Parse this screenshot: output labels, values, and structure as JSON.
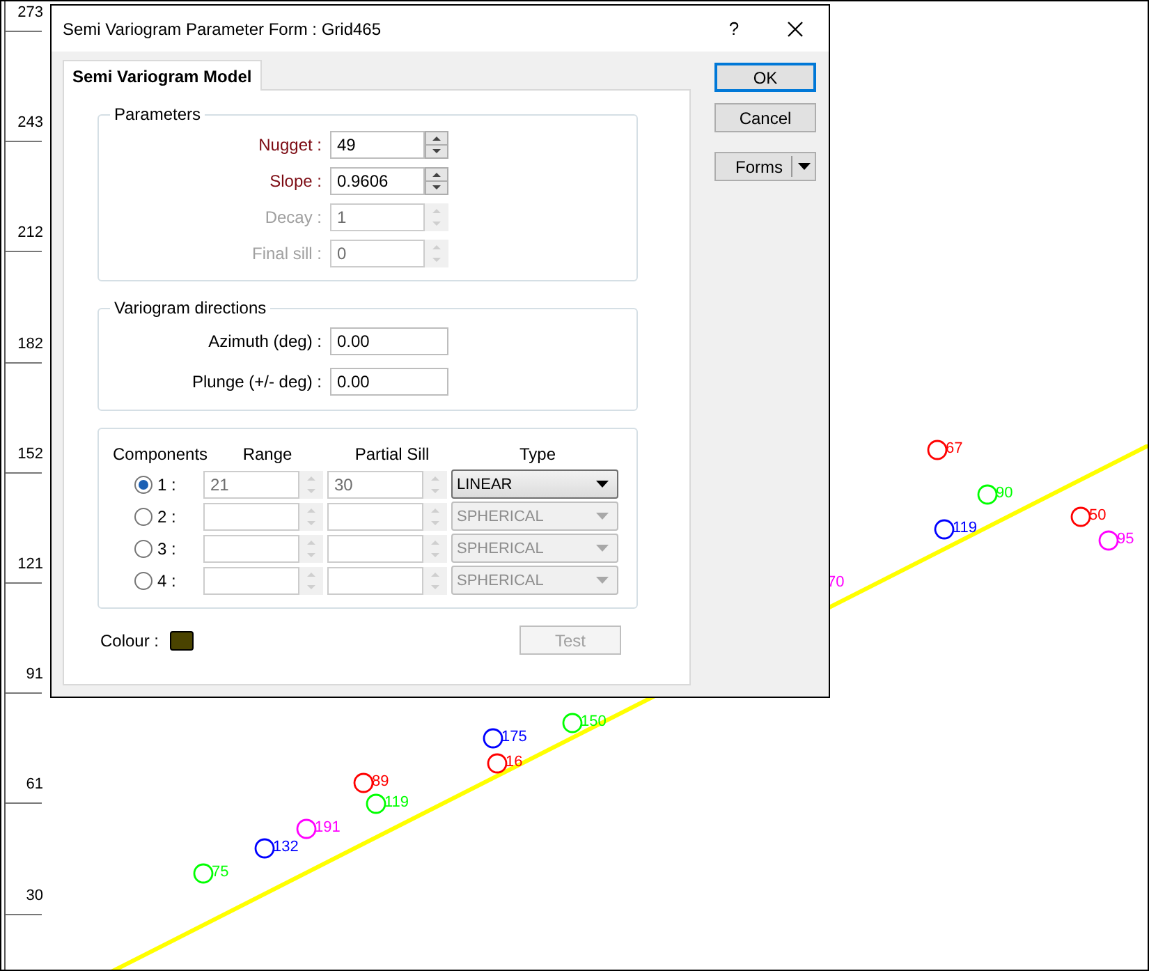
{
  "plot": {
    "y_axis_labels": [
      "273",
      "243",
      "212",
      "182",
      "152",
      "121",
      "91",
      "61",
      "30"
    ],
    "points": [
      {
        "label": "67",
        "color": "#ff0000"
      },
      {
        "label": "90",
        "color": "#00ff00"
      },
      {
        "label": "119",
        "color": "#0000ff"
      },
      {
        "label": "50",
        "color": "#ff0000"
      },
      {
        "label": "95",
        "color": "#ff00ff"
      },
      {
        "label": "175",
        "color": "#0000ff"
      },
      {
        "label": "16",
        "color": "#ff0000"
      },
      {
        "label": "150",
        "color": "#00ff00"
      },
      {
        "label": "89",
        "color": "#ff0000"
      },
      {
        "label": "119",
        "color": "#00ff00"
      },
      {
        "label": "191",
        "color": "#ff00ff"
      },
      {
        "label": "132",
        "color": "#0000ff"
      },
      {
        "label": "75",
        "color": "#00ff00"
      }
    ],
    "hidden_point_labels": [
      {
        "label": "70",
        "color": "#ff00ff"
      }
    ]
  },
  "dialog": {
    "title": "Semi Variogram Parameter Form : Grid465",
    "help": "?",
    "tabs": [
      {
        "label": "Semi Variogram Model",
        "selected": true
      }
    ],
    "parameters": {
      "title": "Parameters",
      "fields": [
        {
          "label": "Nugget :",
          "value": "49",
          "required": true,
          "disabled": false
        },
        {
          "label": "Slope :",
          "value": "0.9606",
          "required": true,
          "disabled": false
        },
        {
          "label": "Decay :",
          "value": "1",
          "required": false,
          "disabled": true
        },
        {
          "label": "Final sill :",
          "value": "0",
          "required": false,
          "disabled": true
        }
      ]
    },
    "directions": {
      "title": "Variogram directions",
      "fields": [
        {
          "label": "Azimuth (deg) :",
          "value": "0.00"
        },
        {
          "label": "Plunge (+/- deg) :",
          "value": "0.00"
        }
      ]
    },
    "components": {
      "columns": [
        "Components",
        "Range",
        "Partial Sill",
        "Type"
      ],
      "rows": [
        {
          "label": "1 :",
          "selected": true,
          "range": "21",
          "partial_sill": "30",
          "type": "LINEAR",
          "type_disabled": false
        },
        {
          "label": "2 :",
          "selected": false,
          "type": "SPHERICAL",
          "type_disabled": true
        },
        {
          "label": "3 :",
          "selected": false,
          "type": "SPHERICAL",
          "type_disabled": true
        },
        {
          "label": "4 :",
          "selected": false,
          "type": "SPHERICAL",
          "type_disabled": true
        }
      ]
    },
    "colour": {
      "label": "Colour :",
      "color": "#4a4300"
    },
    "test_button": {
      "label": "Test",
      "disabled": true
    },
    "buttons": [
      {
        "label": "OK",
        "kind": "default"
      },
      {
        "label": "Cancel",
        "kind": "normal"
      },
      {
        "label": "Forms",
        "kind": "split"
      }
    ]
  }
}
